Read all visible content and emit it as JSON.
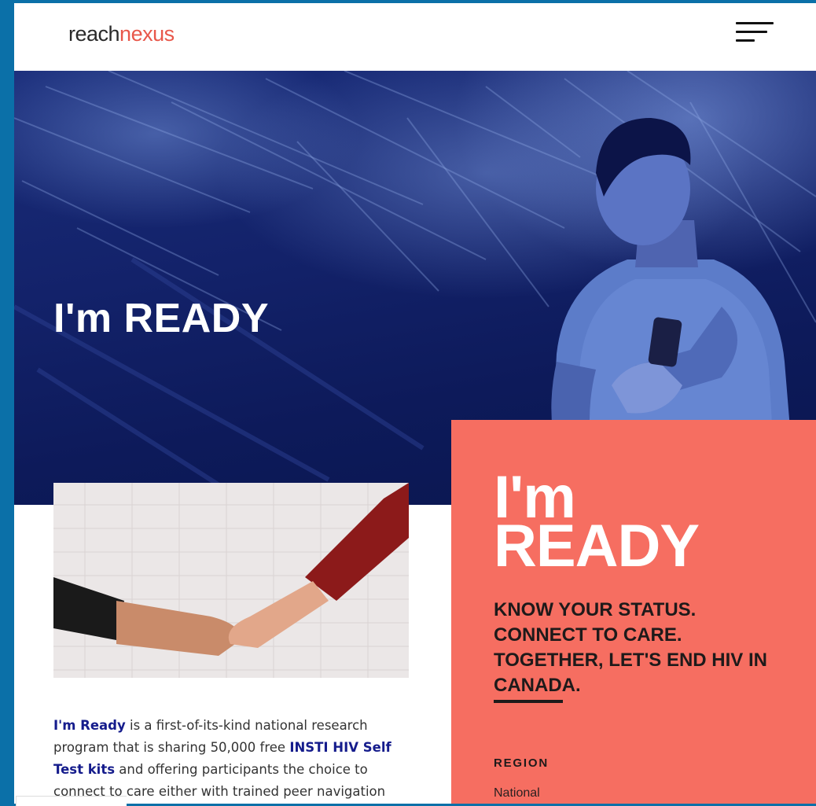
{
  "header": {
    "logo_reach": "reach",
    "logo_nexus": "nexus",
    "menu_icon": "hamburger-menu-icon"
  },
  "hero": {
    "title": "I'm READY"
  },
  "article": {
    "intro_link": "I'm Ready",
    "text_1": " is a first-of-its-kind national research program that is sharing 50,000 free ",
    "kit_link": "INSTI HIV Self Test kits",
    "text_2": " and offering participants the choice to connect to care either with trained peer navigation support or on their own using the program's online"
  },
  "card": {
    "logo_line1": "I'm",
    "logo_line2": "READY",
    "tagline": "KNOW YOUR STATUS. CONNECT TO CARE. TOGETHER, LET'S END HIV IN CANADA.",
    "region_label": "REGION",
    "region_value": "National"
  },
  "colors": {
    "accent_coral": "#f66e61",
    "brand_red": "#e8574a",
    "hero_navy": "#13226a",
    "link_navy": "#151c8c",
    "background_blue": "#0b70a8"
  }
}
